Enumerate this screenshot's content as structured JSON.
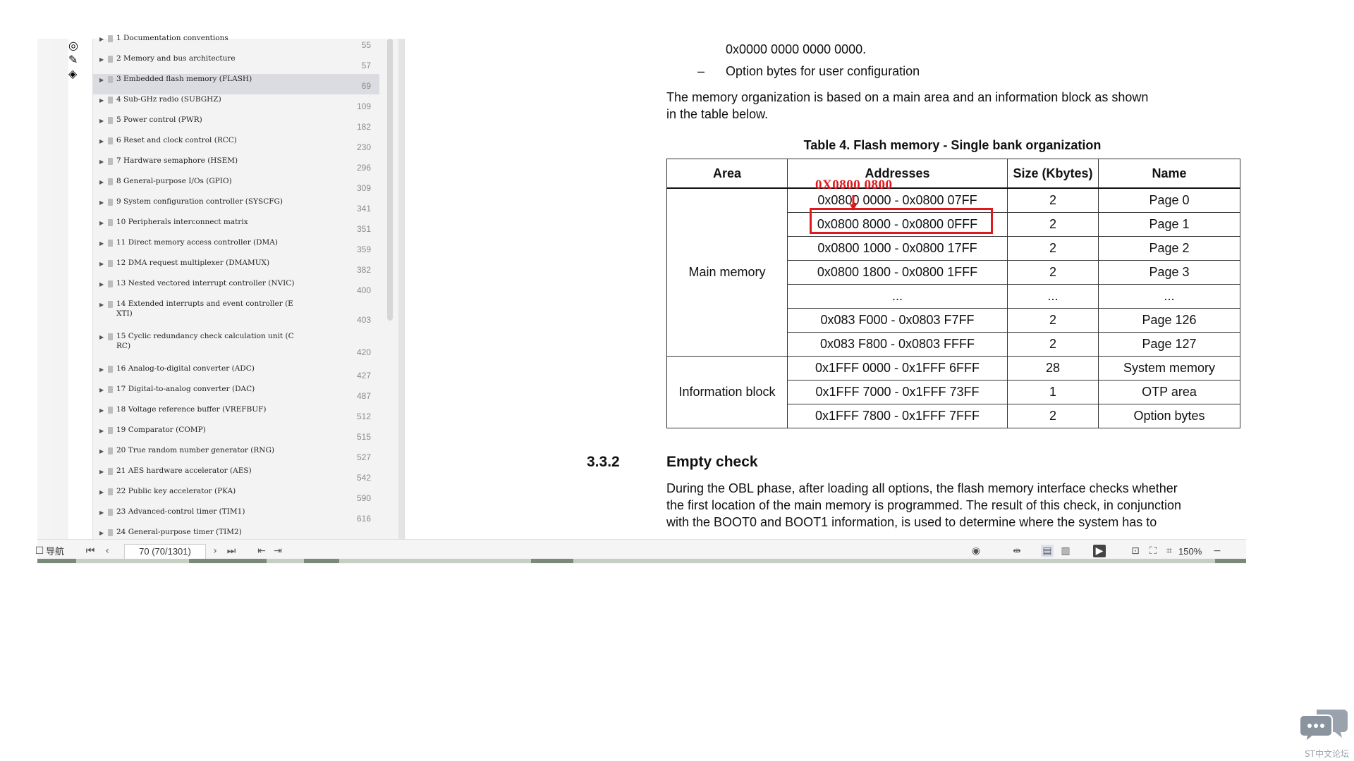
{
  "toc": [
    {
      "label": "1 Documentation conventions",
      "page": "55"
    },
    {
      "label": "2 Memory and bus architecture",
      "page": "57"
    },
    {
      "label": "3 Embedded flash memory (FLASH)",
      "page": "69",
      "selected": true
    },
    {
      "label": "4 Sub-GHz radio (SUBGHZ)",
      "page": "109"
    },
    {
      "label": "5 Power control (PWR)",
      "page": "182"
    },
    {
      "label": "6 Reset and clock control (RCC)",
      "page": "230"
    },
    {
      "label": "7 Hardware semaphore (HSEM)",
      "page": "296"
    },
    {
      "label": "8 General-purpose I/Os (GPIO)",
      "page": "309"
    },
    {
      "label": "9 System configuration controller (SYSCFG)",
      "page": "341"
    },
    {
      "label": "10 Peripherals interconnect matrix",
      "page": "351"
    },
    {
      "label": "11 Direct memory access controller (DMA)",
      "page": "359"
    },
    {
      "label": "12 DMA request multiplexer (DMAMUX)",
      "page": "382"
    },
    {
      "label": "13 Nested vectored interrupt controller (NVIC)",
      "page": "400"
    },
    {
      "label": "14 Extended interrupts and event controller (E XTI)",
      "page": "403"
    },
    {
      "label": "15 Cyclic redundancy check calculation unit (C RC)",
      "page": "420"
    },
    {
      "label": "16 Analog-to-digital converter (ADC)",
      "page": "427"
    },
    {
      "label": "17 Digital-to-analog converter (DAC)",
      "page": "487"
    },
    {
      "label": "18 Voltage reference buffer (VREFBUF)",
      "page": "512"
    },
    {
      "label": "19 Comparator (COMP)",
      "page": "515"
    },
    {
      "label": "20 True random number generator (RNG)",
      "page": "527"
    },
    {
      "label": "21 AES hardware accelerator (AES)",
      "page": "542"
    },
    {
      "label": "22 Public key accelerator (PKA)",
      "page": "590"
    },
    {
      "label": "23 Advanced-control timer (TIM1)",
      "page": "616"
    },
    {
      "label": "24 General-purpose timer (TIM2)",
      "page": ""
    }
  ],
  "doc": {
    "line_top": "0x0000 0000 0000 0000.",
    "bullet_dash": "–",
    "bullet_text": "Option bytes for user configuration",
    "para1": "The memory organization is based on a main area and an information block as shown in the table below.",
    "table_title": "Table 4. Flash memory - Single bank organization",
    "headers": [
      "Area",
      "Addresses",
      "Size (Kbytes)",
      "Name"
    ],
    "main_memory_label": "Main memory",
    "info_block_label": "Information block",
    "rows": [
      {
        "addr": "0x0800 0000 - 0x0800 07FF",
        "size": "2",
        "name": "Page 0"
      },
      {
        "addr": "0x0800 8000 - 0x0800 0FFF",
        "size": "2",
        "name": "Page 1"
      },
      {
        "addr": "0x0800 1000 - 0x0800 17FF",
        "size": "2",
        "name": "Page 2"
      },
      {
        "addr": "0x0800 1800 - 0x0800 1FFF",
        "size": "2",
        "name": "Page 3"
      },
      {
        "addr": "...",
        "size": "...",
        "name": "..."
      },
      {
        "addr": "0x083 F000 - 0x0803 F7FF",
        "size": "2",
        "name": "Page 126"
      },
      {
        "addr": "0x083 F800 - 0x0803 FFFF",
        "size": "2",
        "name": "Page 127"
      },
      {
        "addr": "0x1FFF 0000 - 0x1FFF 6FFF",
        "size": "28",
        "name": "System memory"
      },
      {
        "addr": "0x1FFF 7000 - 0x1FFF 73FF",
        "size": "1",
        "name": "OTP area"
      },
      {
        "addr": "0x1FFF 7800 - 0x1FFF 7FFF",
        "size": "2",
        "name": "Option bytes"
      }
    ],
    "annotation": "0X0800 0800",
    "section_number": "3.3.2",
    "section_title": "Empty check",
    "para2_l1": "During the OBL phase, after loading all options, the flash memory interface checks whether",
    "para2_l2": "the first location of the main memory is programmed. The result of this check, in conjunction",
    "para2_l3": "with the BOOT0 and BOOT1 information, is used to determine where the system has to"
  },
  "statusbar": {
    "nav_label": "导航",
    "page_input": "70 (70/1301)",
    "zoom": "150%"
  },
  "watermark": "ST中文论坛",
  "colors": {
    "annotation_red": "#e0191e",
    "selected_bg": "#dadce2"
  }
}
